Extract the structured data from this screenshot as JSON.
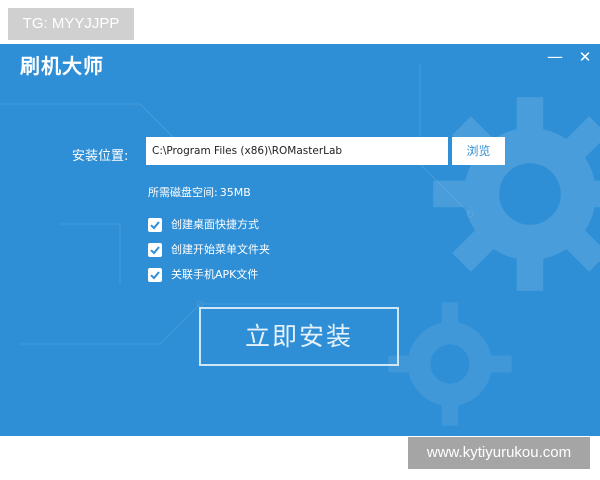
{
  "watermarks": {
    "top_left": "TG: MYYJJPP",
    "bottom_right": "www.kytiyurukou.com"
  },
  "window": {
    "title": "刷机大师",
    "minimize_glyph": "—",
    "close_glyph": "✕"
  },
  "install": {
    "path_label": "安装位置:",
    "path_value": "C:\\Program Files (x86)\\ROMasterLab",
    "browse_label": "浏览",
    "space_label": "所需磁盘空间:",
    "space_value": "35MB",
    "options": [
      {
        "label": "创建桌面快捷方式",
        "checked": true
      },
      {
        "label": "创建开始菜单文件夹",
        "checked": true
      },
      {
        "label": "关联手机APK文件",
        "checked": true
      }
    ],
    "install_button": "立即安装"
  },
  "colors": {
    "background": "#2f8fd6",
    "text": "#ffffff"
  },
  "icons": [
    "minimize-icon",
    "close-icon",
    "checkmark-icon"
  ]
}
